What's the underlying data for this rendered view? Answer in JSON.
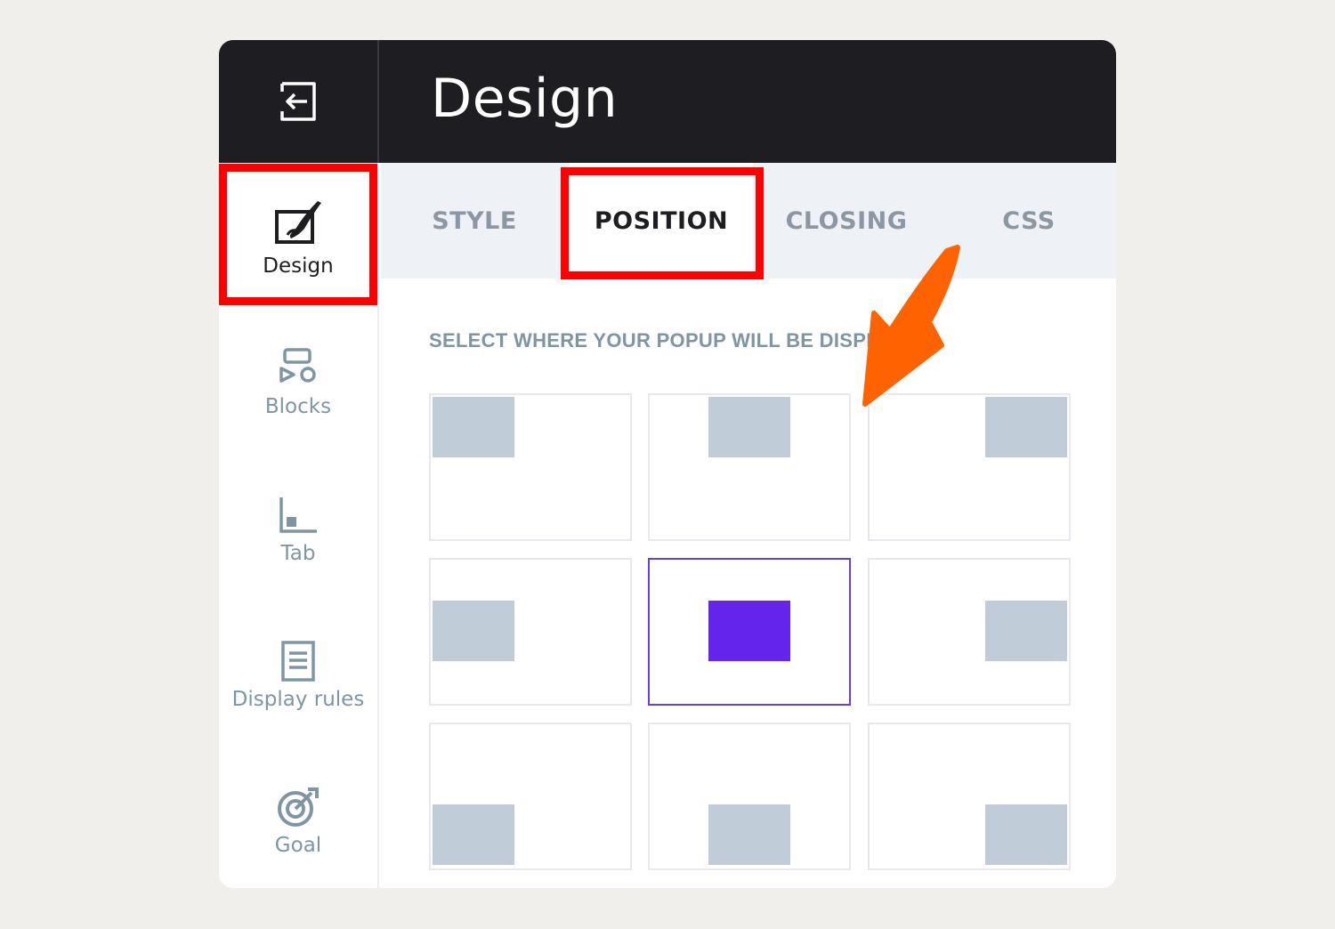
{
  "header": {
    "title": "Design",
    "exit_icon": "exit-icon"
  },
  "sidebar": {
    "items": [
      {
        "label": "Design",
        "icon": "brush-icon",
        "active": true
      },
      {
        "label": "Blocks",
        "icon": "blocks-icon",
        "active": false
      },
      {
        "label": "Tab",
        "icon": "tab-icon",
        "active": false
      },
      {
        "label": "Display rules",
        "icon": "list-icon",
        "active": false
      },
      {
        "label": "Goal",
        "icon": "target-icon",
        "active": false
      }
    ]
  },
  "tabs": [
    {
      "label": "STYLE",
      "active": false
    },
    {
      "label": "POSITION",
      "active": true
    },
    {
      "label": "CLOSING",
      "active": false
    },
    {
      "label": "CSS",
      "active": false
    }
  ],
  "position": {
    "label": "SELECT WHERE YOUR POPUP WILL BE DISPLAYED",
    "selected": "middle-center",
    "options": [
      "top-left",
      "top-center",
      "top-right",
      "middle-left",
      "middle-center",
      "middle-right",
      "bottom-left",
      "bottom-center",
      "bottom-right"
    ]
  },
  "colors": {
    "accent": "#6424ec",
    "highlight": "#ff0000",
    "arrow": "#ff6200"
  }
}
